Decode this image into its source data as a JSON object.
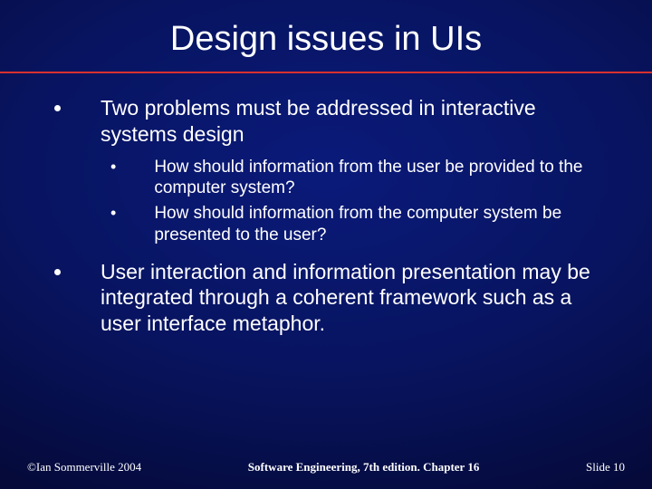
{
  "title": "Design issues in UIs",
  "bullets": {
    "b1": "Two problems must be addressed in interactive systems design",
    "s1": "How should information from the user be provided to the computer system?",
    "s2": "How should information from the computer system be presented to the user?",
    "b2": "User interaction and information presentation may be integrated through a coherent framework such as a user interface metaphor."
  },
  "footer": {
    "left": "©Ian Sommerville 2004",
    "center": "Software Engineering, 7th edition. Chapter 16",
    "right": "Slide 10"
  }
}
